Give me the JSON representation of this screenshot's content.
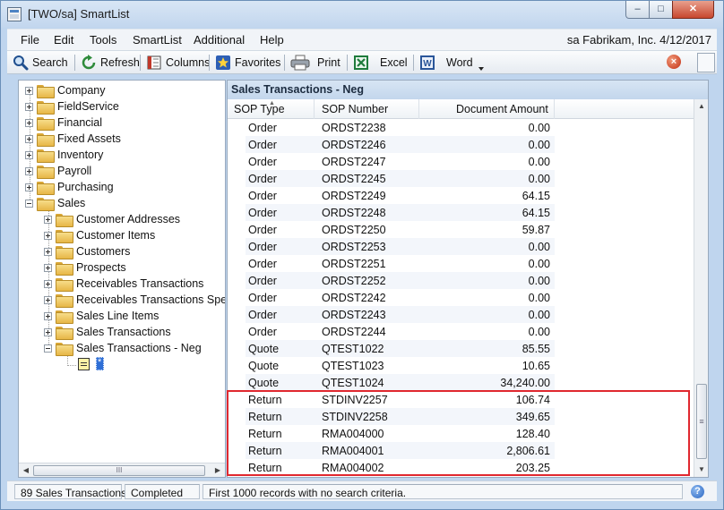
{
  "window": {
    "title": "[TWO/sa] SmartList"
  },
  "menu": {
    "items": [
      "File",
      "Edit",
      "Tools",
      "SmartList",
      "Additional",
      "Help"
    ],
    "info": "sa  Fabrikam, Inc.  4/12/2017"
  },
  "toolbar": {
    "search": "Search",
    "refresh": "Refresh",
    "columns": "Columns",
    "favorites": "Favorites",
    "print": "Print",
    "excel": "Excel",
    "word": "Word"
  },
  "tree": {
    "items": [
      "Company",
      "FieldService",
      "Financial",
      "Fixed Assets",
      "Inventory",
      "Payroll",
      "Purchasing",
      "Sales",
      "Customer Addresses",
      "Customer Items",
      "Customers",
      "Prospects",
      "Receivables Transactions",
      "Receivables Transactions Speci",
      "Sales Line Items",
      "Sales Transactions",
      "Sales Transactions - Neg"
    ],
    "hscroll_grip": "III"
  },
  "grid": {
    "title": "Sales Transactions - Neg",
    "columns": [
      "SOP Type",
      "SOP Number",
      "Document Amount"
    ],
    "rows": [
      [
        "Order",
        "ORDST2238",
        "0.00"
      ],
      [
        "Order",
        "ORDST2246",
        "0.00"
      ],
      [
        "Order",
        "ORDST2247",
        "0.00"
      ],
      [
        "Order",
        "ORDST2245",
        "0.00"
      ],
      [
        "Order",
        "ORDST2249",
        "64.15"
      ],
      [
        "Order",
        "ORDST2248",
        "64.15"
      ],
      [
        "Order",
        "ORDST2250",
        "59.87"
      ],
      [
        "Order",
        "ORDST2253",
        "0.00"
      ],
      [
        "Order",
        "ORDST2251",
        "0.00"
      ],
      [
        "Order",
        "ORDST2252",
        "0.00"
      ],
      [
        "Order",
        "ORDST2242",
        "0.00"
      ],
      [
        "Order",
        "ORDST2243",
        "0.00"
      ],
      [
        "Order",
        "ORDST2244",
        "0.00"
      ],
      [
        "Quote",
        "QTEST1022",
        "85.55"
      ],
      [
        "Quote",
        "QTEST1023",
        "10.65"
      ],
      [
        "Quote",
        "QTEST1024",
        "34,240.00"
      ],
      [
        "Return",
        "STDINV2257",
        "106.74"
      ],
      [
        "Return",
        "STDINV2258",
        "349.65"
      ],
      [
        "Return",
        "RMA004000",
        "128.40"
      ],
      [
        "Return",
        "RMA004001",
        "2,806.61"
      ],
      [
        "Return",
        "RMA004002",
        "203.25"
      ]
    ],
    "vscroll_grip": "≡"
  },
  "status": {
    "count": "89 Sales Transactions",
    "state": "Completed",
    "message": "First 1000 records with no search criteria."
  },
  "colors": {
    "highlight": "#e0282f",
    "title_bar": "#c2d6ee",
    "selection": "#2f6fd6"
  }
}
